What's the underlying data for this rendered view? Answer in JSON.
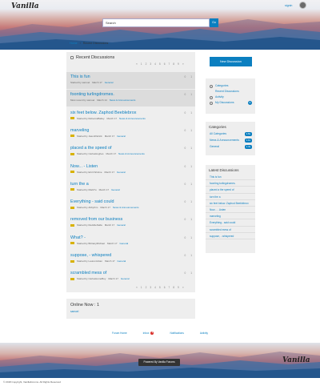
{
  "header": {
    "logo": "Vanilla",
    "signin": "signin",
    "search_value": "Search",
    "search_button": "Go"
  },
  "breadcrumb": [
    "Home",
    "›",
    "Recent Discussions"
  ],
  "main": {
    "title": "Recent Discussions",
    "pager": [
      "«",
      "1",
      "2",
      "3",
      "4",
      "5",
      "6",
      "7",
      "8",
      "9",
      "»"
    ],
    "discussions": [
      {
        "title": "This is fun",
        "meta": "Started by samuel",
        "date": "March 17",
        "category": "General",
        "views": "0",
        "comments": "1",
        "highlight": true
      },
      {
        "title": "foonting turlingdromes.",
        "meta": "Most recent by samuel",
        "date": "March 14",
        "category": "News & Announcements",
        "views": "0",
        "comments": "1",
        "highlight": true
      },
      {
        "title": "six feet below. Zaphod Beeblebrox",
        "meta": "Started by RebeccaBailey",
        "date": "March 17",
        "category": "News & Announcements",
        "views": "0",
        "comments": "1",
        "highlight": false
      },
      {
        "title": "marveling",
        "meta": "Started by JasonPatrick",
        "date": "March 17",
        "category": "General",
        "views": "0",
        "comments": "1",
        "highlight": false
      },
      {
        "title": "placed a  the speed of",
        "meta": "Started by CarlosHughes",
        "date": "March 17",
        "category": "News & Announcements",
        "views": "0",
        "comments": "1",
        "highlight": false
      },
      {
        "title": "Now... - Listen",
        "meta": "Started by EricChristine",
        "date": "March 17",
        "category": "General",
        "views": "0",
        "comments": "1",
        "highlight": false
      },
      {
        "title": "turn the  a",
        "meta": "Started by MarkTu",
        "date": "March 17",
        "category": "General",
        "views": "0",
        "comments": "1",
        "highlight": false
      },
      {
        "title": "Everything - said  could",
        "meta": "Started by AbbyKim",
        "date": "March 17",
        "category": "News & Announcements",
        "views": "0",
        "comments": "1",
        "highlight": false
      },
      {
        "title": "removed from our business",
        "meta": "Started by RedditeNalla",
        "date": "March 17",
        "category": "General",
        "views": "0",
        "comments": "1",
        "highlight": false
      },
      {
        "title": "What? -",
        "meta": "Started by BrittanyMichael",
        "date": "March 17",
        "category": "General",
        "views": "0",
        "comments": "1",
        "highlight": false
      },
      {
        "title": "suppose, - whispered",
        "meta": "Started by LaurenJuban",
        "date": "March 17",
        "category": "General",
        "views": "0",
        "comments": "1",
        "highlight": false
      },
      {
        "title": "scrambled mess of",
        "meta": "Started by CarlosHomeBoy",
        "date": "March 17",
        "category": "General",
        "views": "0",
        "comments": "1",
        "highlight": false
      }
    ]
  },
  "online": {
    "title": "Online Now : 1",
    "user": "samuel"
  },
  "sidebar": {
    "new_discussion": "New Discussion",
    "nav": [
      {
        "label": "Categories",
        "icon": "categories-icon"
      },
      {
        "label": "Recent Discussions",
        "icon": "none"
      },
      {
        "label": "Activity",
        "icon": "activity-icon"
      },
      {
        "label": "My Discussions",
        "icon": "star-icon",
        "badge": "6"
      }
    ],
    "categories_title": "Categories",
    "categories": [
      {
        "label": "All Categories",
        "count": "1.6k"
      },
      {
        "label": "News & Announcements",
        "count": "1.1k"
      },
      {
        "label": "General",
        "count": "1.4k"
      }
    ],
    "latest_title": "Latest Discussions",
    "latest": [
      "This is fun",
      "foonting turlingdromes.",
      "placed a  the speed of",
      "turn the  a",
      "six feet below. Zaphod Beeblebrox",
      "Now... - Listen",
      "marveling",
      "Everything - said  could",
      "scrambled mess of",
      "suppose, - whispered"
    ]
  },
  "footer": {
    "links": [
      {
        "label": "Forum Home"
      },
      {
        "label": "Inbox",
        "badge": "6"
      },
      {
        "label": "Notifications"
      },
      {
        "label": "Activity"
      }
    ],
    "powered": "Powered By Vanilla Forums",
    "logo": "Vanilla",
    "copyright": "© 2018 Copyright, VanillaForums. All Rights Reserved"
  },
  "colors": {
    "accent": "#0b7fc0",
    "panel": "#eeeeee",
    "badge_red": "#d9302c"
  }
}
